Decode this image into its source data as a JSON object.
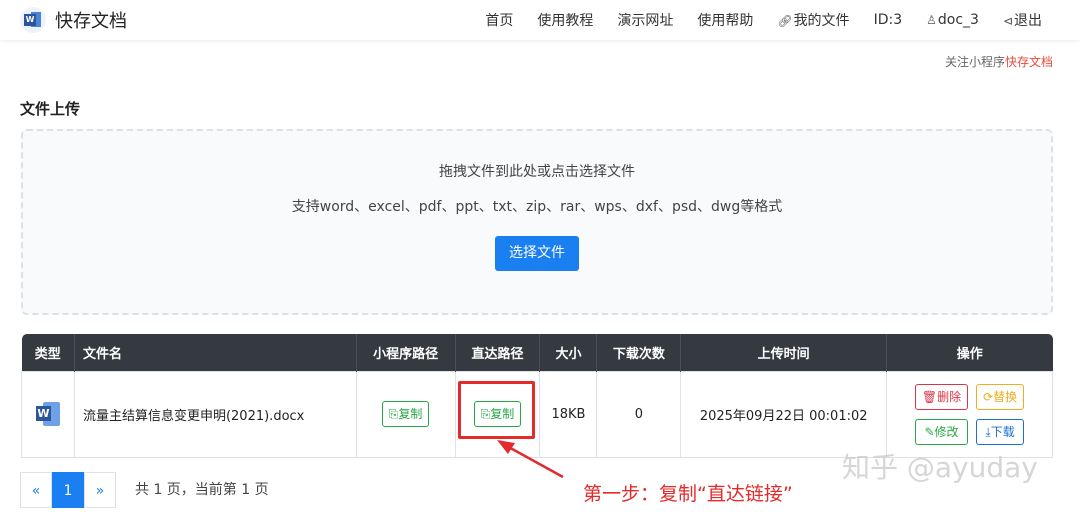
{
  "header": {
    "brand": "快存文档",
    "nav": [
      {
        "label": "首页"
      },
      {
        "label": "使用教程"
      },
      {
        "label": "演示网址"
      },
      {
        "label": "使用帮助"
      },
      {
        "label": "我的文件",
        "icon": "link-icon"
      },
      {
        "label": "ID:3"
      },
      {
        "label": "doc_3",
        "icon": "user-icon"
      },
      {
        "label": "退出",
        "icon": "logout-icon"
      }
    ]
  },
  "follow": {
    "prefix": "关注小程序",
    "highlight": "快存文档"
  },
  "upload": {
    "title": "文件上传",
    "hint": "拖拽文件到此处或点击选择文件",
    "formats": "支持word、excel、pdf、ppt、txt、zip、rar、wps、dxf、psd、dwg等格式",
    "button": "选择文件"
  },
  "table": {
    "headers": [
      "类型",
      "文件名",
      "小程序路径",
      "直达路径",
      "大小",
      "下载次数",
      "上传时间",
      "操作"
    ],
    "rows": [
      {
        "type_icon": "word-doc-icon",
        "filename": "流量主结算信息变更申明(2021).docx",
        "mini_path_btn": "复制",
        "direct_path_btn": "复制",
        "size": "18KB",
        "downloads": "0",
        "uploaded": "2025年09月22日 00:01:02",
        "actions": {
          "delete": "删除",
          "replace": "替换",
          "edit": "修改",
          "download": "下载"
        }
      }
    ]
  },
  "pager": {
    "prev": "«",
    "current": "1",
    "next": "»",
    "info": "共 1 页，当前第 1 页"
  },
  "annotation": {
    "text": "第一步：复制“直达链接”",
    "color": "#e32b2b"
  },
  "watermark": "知乎 @ayuday",
  "colors": {
    "primary": "#1a7ff0",
    "header_dark": "#343a40",
    "success": "#28a745",
    "danger": "#dc3545",
    "warning": "#f0ad1e"
  }
}
